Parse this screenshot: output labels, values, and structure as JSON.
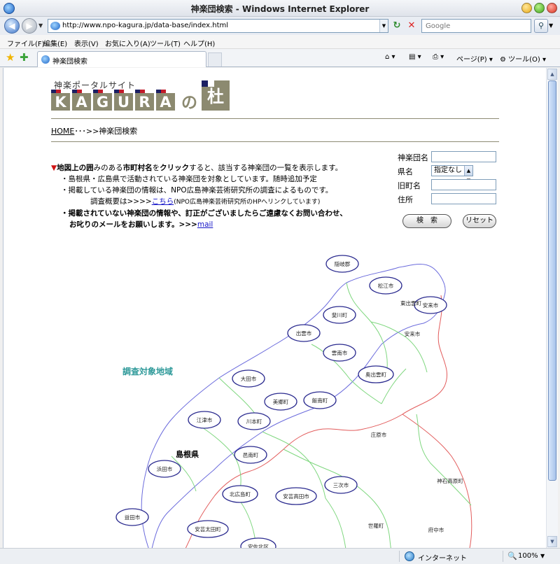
{
  "window": {
    "title": "神楽団検索 - Windows Internet Explorer"
  },
  "address": {
    "url": "http://www.npo-kagura.jp/data-base/index.html",
    "search_placeholder": "Google"
  },
  "menu": [
    "ファイル(F)",
    "編集(E)",
    "表示(V)",
    "お気に入り(A)",
    "ツール(T)",
    "ヘルプ(H)"
  ],
  "tab": {
    "label": "神楽団検索"
  },
  "commands": {
    "page": "ページ(P)",
    "tools": "ツール(O)"
  },
  "page": {
    "tagline": "神楽ポータルサイト",
    "logo_letters": [
      "K",
      "A",
      "G",
      "U",
      "R",
      "A"
    ],
    "logo_no": "の",
    "logo_mori": "杜",
    "breadcrumb_home": "HOME",
    "breadcrumb_rest": "･･･>>神楽団検索",
    "intro": {
      "l1_a": "地図上の囲",
      "l1_b": "みのある",
      "l1_c": "市町村名",
      "l1_d": "を",
      "l1_e": "クリック",
      "l1_f": "すると、該当する神楽団の一覧を表示します。",
      "l2": "・島根県・広島県で活動されている神楽団を対象としています。随時追加予定",
      "l3": "・掲載している神楽団の情報は、NPO広島神楽芸術研究所の調査によるものです。",
      "l4_a": "調査概要は>>>>",
      "l4_link": "こちら",
      "l4_b": "(NPO広島神楽芸術研究所のHPへリンクしています)",
      "l5": "・掲載されていない神楽団の情報や、訂正がございましたらご遠慮なくお問い合わせ、",
      "l6_a": "お叱りのメールをお願いします。>>>",
      "l6_link": "mail"
    },
    "form": {
      "name_label": "神楽団名",
      "pref_label": "県名",
      "pref_value": "指定なし",
      "old_town_label": "旧町名",
      "address_label": "住所",
      "search_button": "検　索",
      "reset_button": "リセット"
    },
    "map": {
      "area_title": "調査対象地域",
      "prefecture": "島根県",
      "circled": [
        "隠岐郡",
        "松江市",
        "安来市",
        "出雲市",
        "斐川町",
        "雲南市",
        "奥出雲町",
        "大田市",
        "美郷町",
        "飯南町",
        "江津市",
        "川本町",
        "邑南町",
        "浜田市",
        "北広島町",
        "安芸高田市",
        "三次市",
        "益田市",
        "安芸太田町",
        "安佐北区"
      ],
      "plain": [
        "東出雲町",
        "安来市",
        "庄原市",
        "神石高原町",
        "世羅町",
        "府中市"
      ]
    }
  },
  "status": {
    "zone": "インターネット",
    "zoom": "100%"
  }
}
